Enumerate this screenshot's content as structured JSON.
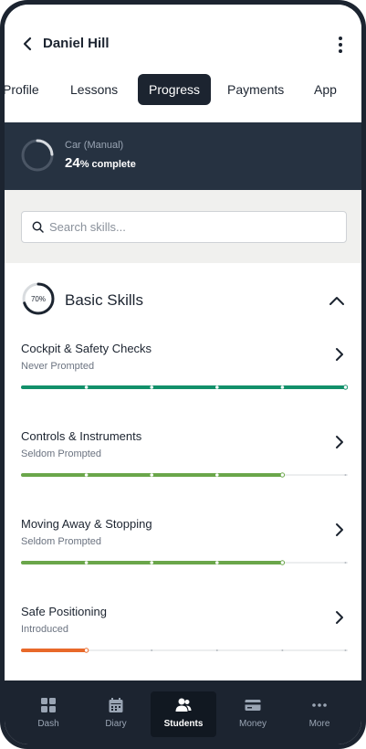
{
  "header": {
    "title": "Daniel Hill"
  },
  "tabs": [
    {
      "label": "Profile"
    },
    {
      "label": "Lessons"
    },
    {
      "label": "Progress",
      "active": true
    },
    {
      "label": "Payments"
    },
    {
      "label": "App"
    }
  ],
  "course": {
    "name": "Car (Manual)",
    "percent": "24",
    "suffix": "% complete",
    "progress": 0.24
  },
  "search": {
    "placeholder": "Search skills..."
  },
  "section": {
    "title": "Basic Skills",
    "ring_label": "70%",
    "progress": 0.7
  },
  "skills": [
    {
      "name": "Cockpit & Safety Checks",
      "status": "Never Prompted",
      "level": 5,
      "color": "#12906a"
    },
    {
      "name": "Controls & Instruments",
      "status": "Seldom Prompted",
      "level": 4,
      "color": "#6aa64a"
    },
    {
      "name": "Moving Away & Stopping",
      "status": "Seldom Prompted",
      "level": 4,
      "color": "#6aa64a"
    },
    {
      "name": "Safe Positioning",
      "status": "Introduced",
      "level": 1,
      "color": "#e8692a"
    }
  ],
  "nav": [
    {
      "label": "Dash",
      "icon": "dashboard-icon"
    },
    {
      "label": "Diary",
      "icon": "calendar-icon"
    },
    {
      "label": "Students",
      "icon": "students-icon",
      "active": true
    },
    {
      "label": "Money",
      "icon": "card-icon"
    },
    {
      "label": "More",
      "icon": "more-icon"
    }
  ]
}
